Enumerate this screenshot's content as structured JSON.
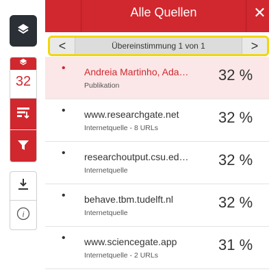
{
  "sidebar": {
    "match_count": "32",
    "icons": {
      "top": "layers-icon",
      "group_top": "layers-icon",
      "sort": "sort-icon",
      "filter": "filter-icon",
      "download": "download-icon",
      "info": "info-icon"
    }
  },
  "header": {
    "title": "Alle Quellen",
    "close_label": "✕"
  },
  "nav": {
    "prev": "<",
    "next": ">",
    "label": "Übereinstimmung 1 von 1"
  },
  "sources": [
    {
      "name": "Andreia Martinho, Ada…",
      "type": "Publikation",
      "percent": "32 %"
    },
    {
      "name": "www.researchgate.net",
      "type": "Internetquelle - 8 URLs",
      "percent": "32 %"
    },
    {
      "name": "researchoutput.csu.ed…",
      "type": "Internetquelle",
      "percent": "32 %"
    },
    {
      "name": "behave.tbm.tudelft.nl",
      "type": "Internetquelle",
      "percent": "32 %"
    },
    {
      "name": "www.sciencegate.app",
      "type": "Internetquelle - 2 URLs",
      "percent": "31 %"
    }
  ],
  "colors": {
    "accent": "#d1272e",
    "dark": "#2b2f36",
    "highlight": "#f2d60b"
  }
}
